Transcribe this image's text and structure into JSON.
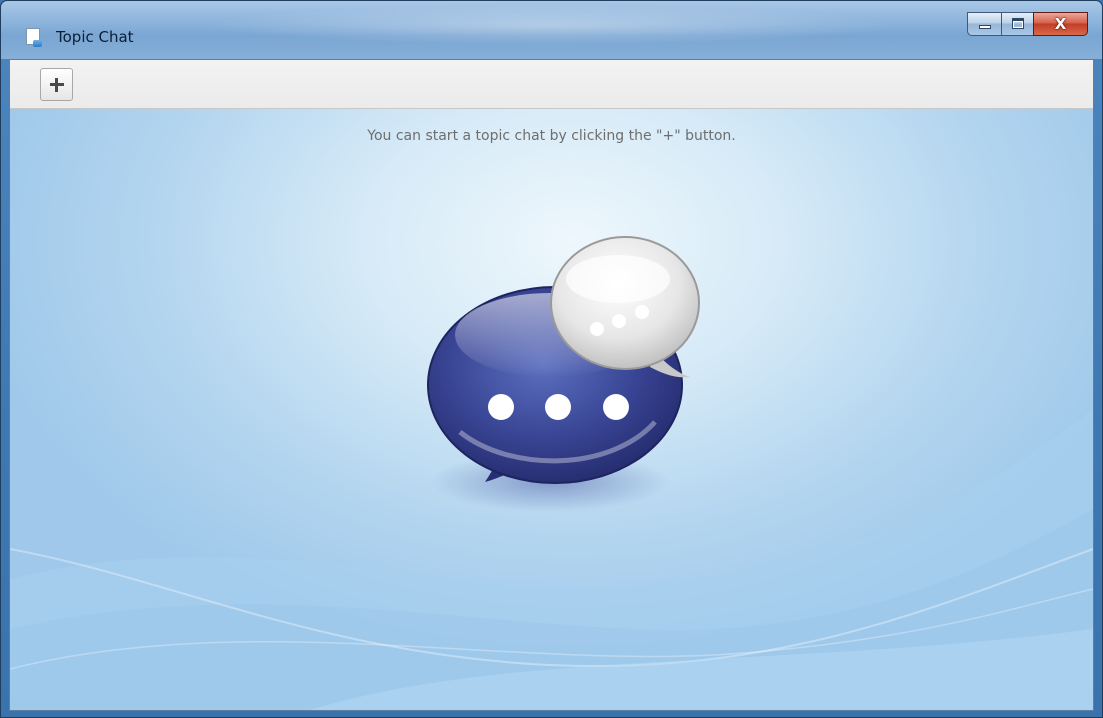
{
  "window": {
    "title": "Topic Chat",
    "app_icon": "document-icon",
    "caption_buttons": {
      "minimize_icon": "minimize-icon",
      "maximize_icon": "maximize-icon",
      "close_label": "X"
    }
  },
  "toolbar": {
    "add_button_icon": "plus-icon"
  },
  "main": {
    "hint_text": "You can start a topic chat by clicking the \"+\" button.",
    "illustration_icon": "chat-bubbles-icon"
  },
  "colors": {
    "titlebar": "#8db4dc",
    "close_button": "#c33d27",
    "bubble_blue": "#35408a",
    "bubble_white": "#f2f2f2",
    "hint_text": "#6e6e6e",
    "background_light": "#eef7fc",
    "background_blue": "#9fc8ea"
  }
}
